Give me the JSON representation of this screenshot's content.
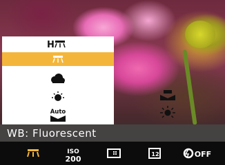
{
  "status": {
    "wb_label": "WB: Fluorescent"
  },
  "menu": {
    "options": [
      {
        "icon": "wb-fluorescent-h-icon",
        "text": "H"
      },
      {
        "icon": "wb-fluorescent-l-icon",
        "selected": true
      },
      {
        "icon": "wb-cloudy-icon"
      },
      {
        "icon": "wb-incandescent-icon"
      },
      {
        "icon": "wb-auto-icon",
        "text": "Auto"
      }
    ],
    "right_options": [
      {
        "icon": "wb-custom-icon"
      },
      {
        "icon": "wb-daylight-icon"
      }
    ]
  },
  "bottom_bar": {
    "iso_top": "ISO",
    "iso_bottom": "200",
    "flash_off": "OFF"
  },
  "colors": {
    "selected": "#f4b63a",
    "menu_bg": "#ffffff",
    "status_bg": "#464646"
  }
}
